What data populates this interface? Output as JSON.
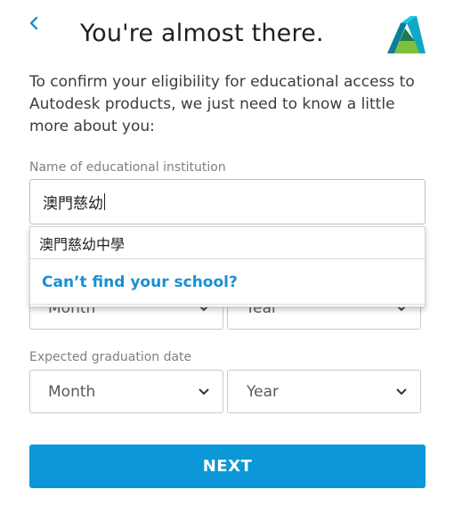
{
  "header": {
    "back_icon": "chevron-left-icon",
    "title": "You're almost there.",
    "logo_icon": "autodesk-logo-icon"
  },
  "intro": "To confirm your eligibility for educational access to Autodesk products, we just need to know a little more about you:",
  "school": {
    "label": "Name of educational institution",
    "value": "澳門慈幼"
  },
  "dropdown": {
    "suggestion": "澳門慈幼中學",
    "cant_find": "Can’t find your school?"
  },
  "enrollment": {
    "month": "Month",
    "year": "Year"
  },
  "graduation": {
    "label": "Expected graduation date",
    "month": "Month",
    "year": "Year"
  },
  "next_button": "NEXT",
  "colors": {
    "accent": "#0b97d8",
    "link": "#1a8fd3",
    "back_chevron": "#1a8fd3"
  }
}
